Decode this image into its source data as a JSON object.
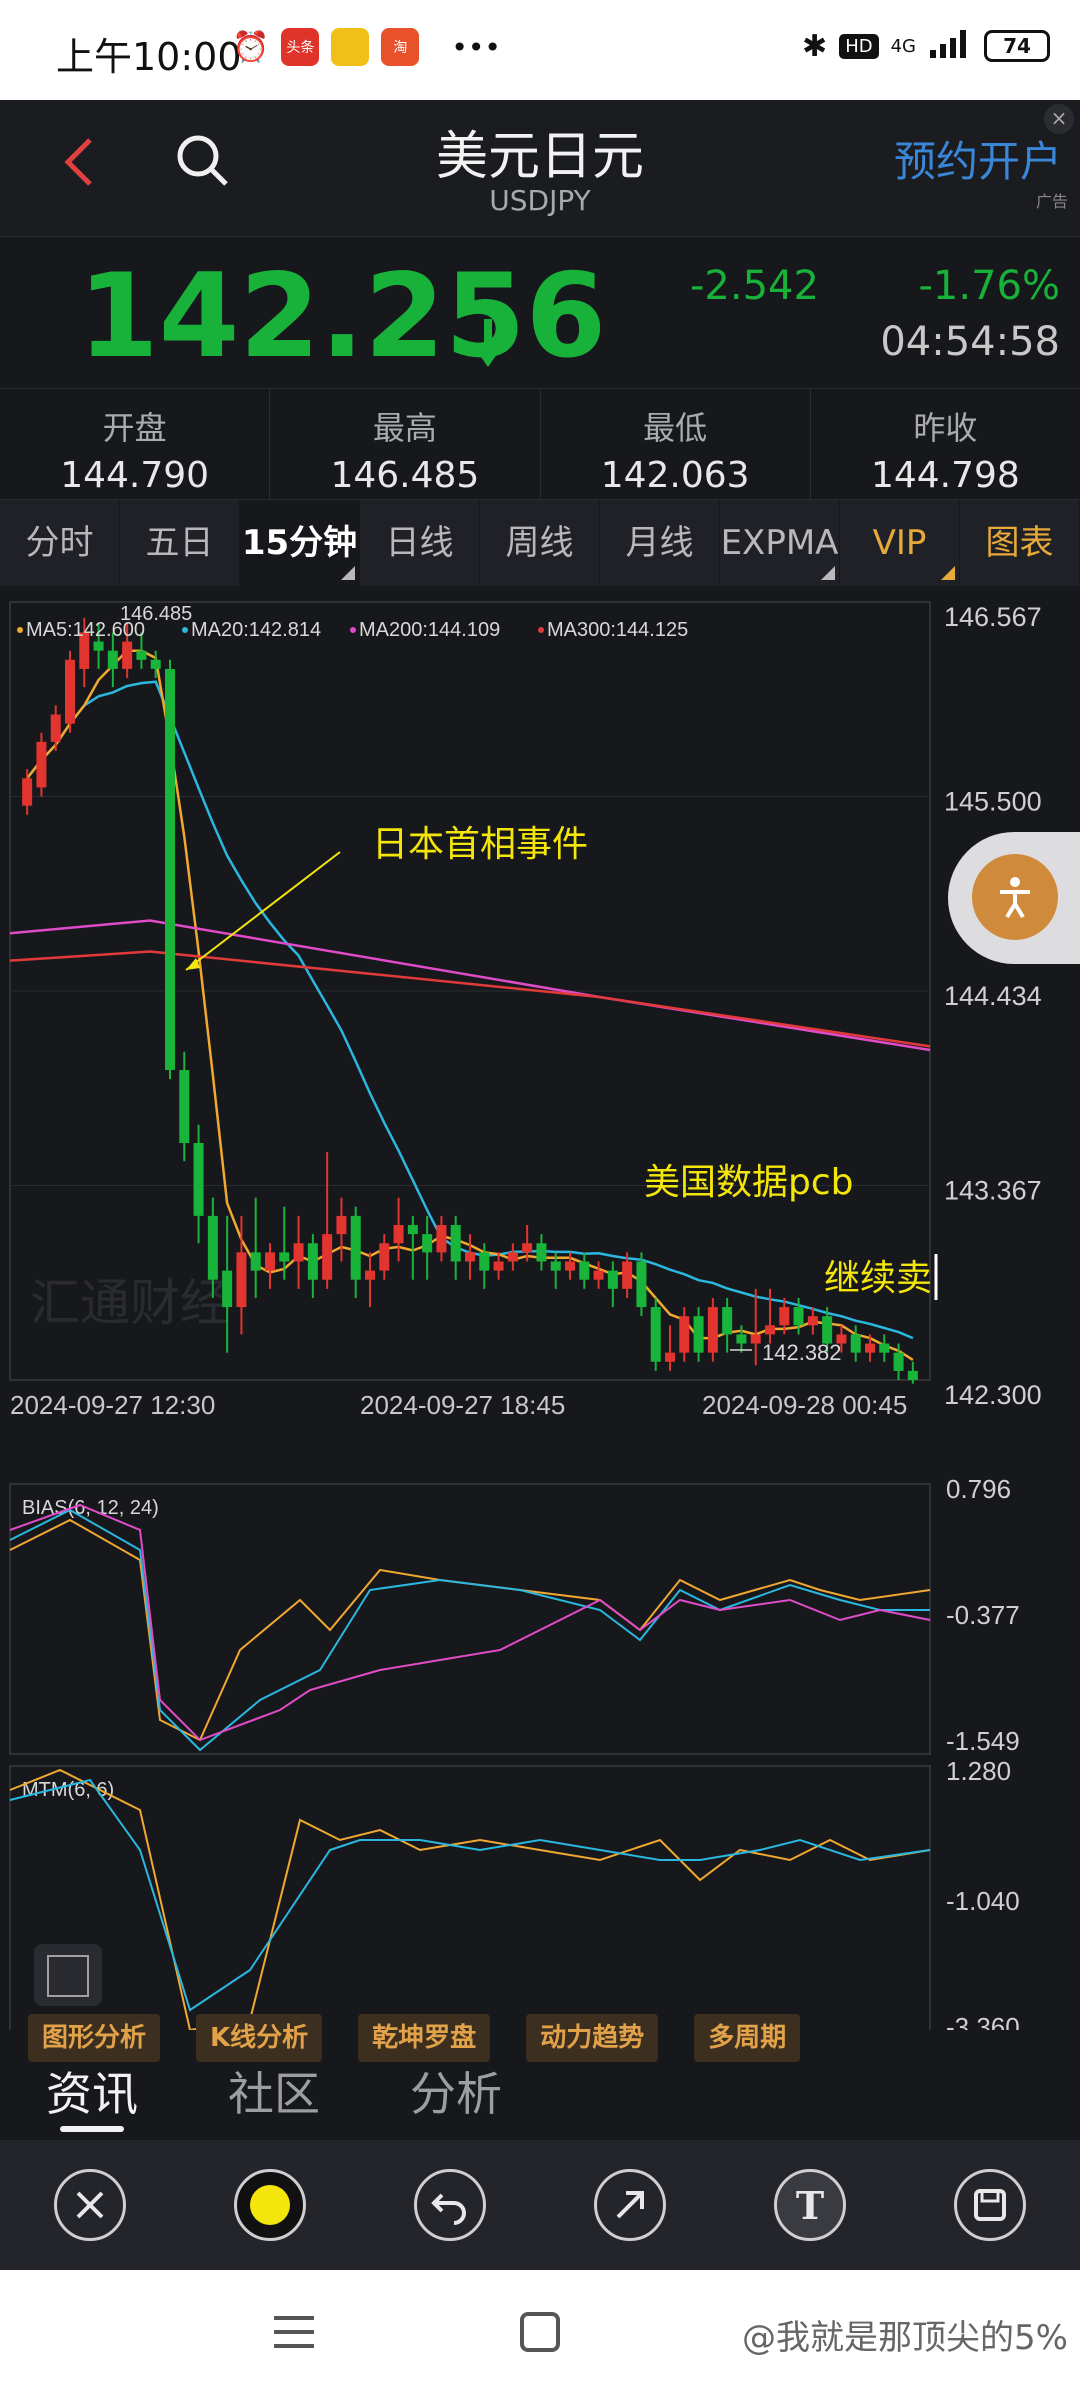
{
  "status": {
    "time": "上午10:00",
    "battery": "74",
    "network": "4G",
    "hd": "HD",
    "app_icons": [
      "头条",
      "",
      "淘"
    ]
  },
  "header": {
    "title": "美元日元",
    "symbol": "USDJPY",
    "ad_button": "预约开户",
    "ad_tag": "广告",
    "ad_close": "×"
  },
  "quote": {
    "price": "142.256",
    "change": "-2.542",
    "change_pct": "-1.76%",
    "time": "04:54:58"
  },
  "stats": [
    {
      "label": "开盘",
      "value": "144.790"
    },
    {
      "label": "最高",
      "value": "146.485"
    },
    {
      "label": "最低",
      "value": "142.063"
    },
    {
      "label": "昨收",
      "value": "144.798"
    }
  ],
  "tabs": [
    {
      "label": "分时"
    },
    {
      "label": "五日"
    },
    {
      "label": "15分钟"
    },
    {
      "label": "日线"
    },
    {
      "label": "周线"
    },
    {
      "label": "月线"
    },
    {
      "label": "EXPMA"
    },
    {
      "label": "VIP"
    },
    {
      "label": "图表"
    }
  ],
  "chart_data": {
    "type": "candlestick",
    "legend": [
      "MA5:142.600",
      "MA20:142.814",
      "MA200:144.109",
      "MA300:144.125"
    ],
    "legend_colors": [
      "#f0a830",
      "#2ab7e0",
      "#e04cc8",
      "#e23a3a"
    ],
    "y_ticks": [
      "146.567",
      "145.500",
      "144.434",
      "143.367",
      "142.300"
    ],
    "x_ticks": [
      "2024-09-27 12:30",
      "2024-09-27 18:45",
      "2024-09-28 00:45"
    ],
    "high_label": "146.485",
    "low_label": "142.382",
    "annotations": [
      "日本首相事件",
      "美国数据pcb",
      "继续卖"
    ],
    "watermark": "汇通财经",
    "ylim": [
      142.3,
      146.567
    ],
    "candles": [
      [
        145.45,
        145.6,
        145.4,
        145.65
      ],
      [
        145.55,
        145.8,
        145.5,
        145.85
      ],
      [
        145.8,
        145.95,
        145.75,
        146.0
      ],
      [
        145.9,
        146.25,
        145.85,
        146.3
      ],
      [
        146.2,
        146.4,
        146.1,
        146.48
      ],
      [
        146.35,
        146.3,
        146.2,
        146.45
      ],
      [
        146.3,
        146.2,
        146.1,
        146.4
      ],
      [
        146.2,
        146.35,
        146.15,
        146.45
      ],
      [
        146.3,
        146.25,
        146.2,
        146.4
      ],
      [
        146.25,
        146.2,
        146.15,
        146.3
      ],
      [
        146.2,
        144.0,
        143.95,
        146.25
      ],
      [
        144.0,
        143.6,
        143.5,
        144.1
      ],
      [
        143.6,
        143.2,
        143.05,
        143.7
      ],
      [
        143.2,
        142.85,
        142.75,
        143.3
      ],
      [
        142.9,
        142.7,
        142.45,
        143.2
      ],
      [
        142.7,
        143.0,
        142.55,
        143.2
      ],
      [
        143.0,
        142.9,
        142.75,
        143.3
      ],
      [
        142.9,
        143.0,
        142.8,
        143.05
      ],
      [
        143.0,
        142.95,
        142.85,
        143.25
      ],
      [
        142.95,
        143.05,
        142.8,
        143.2
      ],
      [
        143.05,
        142.85,
        142.75,
        143.1
      ],
      [
        142.85,
        143.1,
        142.8,
        143.55
      ],
      [
        143.1,
        143.2,
        142.95,
        143.3
      ],
      [
        143.2,
        142.85,
        142.75,
        143.25
      ],
      [
        142.85,
        142.9,
        142.7,
        143.0
      ],
      [
        142.9,
        143.05,
        142.85,
        143.1
      ],
      [
        143.05,
        143.15,
        142.95,
        143.3
      ],
      [
        143.15,
        143.1,
        142.85,
        143.2
      ],
      [
        143.1,
        143.0,
        142.85,
        143.2
      ],
      [
        143.0,
        143.15,
        142.95,
        143.2
      ],
      [
        143.15,
        142.95,
        142.85,
        143.2
      ],
      [
        142.95,
        143.0,
        142.85,
        143.1
      ],
      [
        143.0,
        142.9,
        142.8,
        143.05
      ],
      [
        142.9,
        142.95,
        142.85,
        143.0
      ],
      [
        142.95,
        143.0,
        142.9,
        143.05
      ],
      [
        143.0,
        143.05,
        142.95,
        143.15
      ],
      [
        143.05,
        142.95,
        142.9,
        143.1
      ],
      [
        142.95,
        142.9,
        142.8,
        143.0
      ],
      [
        142.9,
        142.95,
        142.85,
        143.0
      ],
      [
        142.95,
        142.85,
        142.8,
        143.0
      ],
      [
        142.85,
        142.9,
        142.8,
        142.95
      ],
      [
        142.9,
        142.8,
        142.7,
        142.95
      ],
      [
        142.8,
        142.95,
        142.75,
        143.0
      ],
      [
        142.95,
        142.7,
        142.65,
        143.0
      ],
      [
        142.7,
        142.4,
        142.35,
        142.75
      ],
      [
        142.4,
        142.45,
        142.35,
        142.6
      ],
      [
        142.45,
        142.65,
        142.4,
        142.7
      ],
      [
        142.65,
        142.45,
        142.4,
        142.7
      ],
      [
        142.45,
        142.7,
        142.4,
        142.75
      ],
      [
        142.7,
        142.55,
        142.45,
        142.75
      ],
      [
        142.55,
        142.5,
        142.45,
        142.6
      ],
      [
        142.5,
        142.55,
        142.38,
        142.8
      ],
      [
        142.55,
        142.6,
        142.5,
        142.8
      ],
      [
        142.6,
        142.7,
        142.55,
        142.75
      ],
      [
        142.7,
        142.6,
        142.55,
        142.75
      ],
      [
        142.6,
        142.65,
        142.55,
        142.7
      ],
      [
        142.65,
        142.5,
        142.45,
        142.7
      ],
      [
        142.5,
        142.55,
        142.45,
        142.6
      ],
      [
        142.55,
        142.45,
        142.4,
        142.6
      ],
      [
        142.45,
        142.5,
        142.4,
        142.55
      ],
      [
        142.5,
        142.45,
        142.4,
        142.55
      ],
      [
        142.45,
        142.35,
        142.3,
        142.5
      ],
      [
        142.35,
        142.3,
        142.28,
        142.4
      ]
    ],
    "bias_ticks": [
      "0.796",
      "-0.377",
      "-1.549"
    ],
    "bias_label": "BIAS(6, 12, 24)",
    "mtm_ticks": [
      "1.280",
      "-1.040",
      "-3.360"
    ],
    "mtm_label": "MTM(6, 6)"
  },
  "tools": [
    "图形分析",
    "K线分析",
    "乾坤罗盘",
    "动力趋势",
    "多周期"
  ],
  "news_tabs": [
    "资讯",
    "社区",
    "分析"
  ],
  "draw_toolbar": [
    "close",
    "color",
    "undo",
    "arrow",
    "text",
    "save"
  ],
  "draw_text_glyph": "T",
  "watermark": "@我就是那顶尖的5%"
}
